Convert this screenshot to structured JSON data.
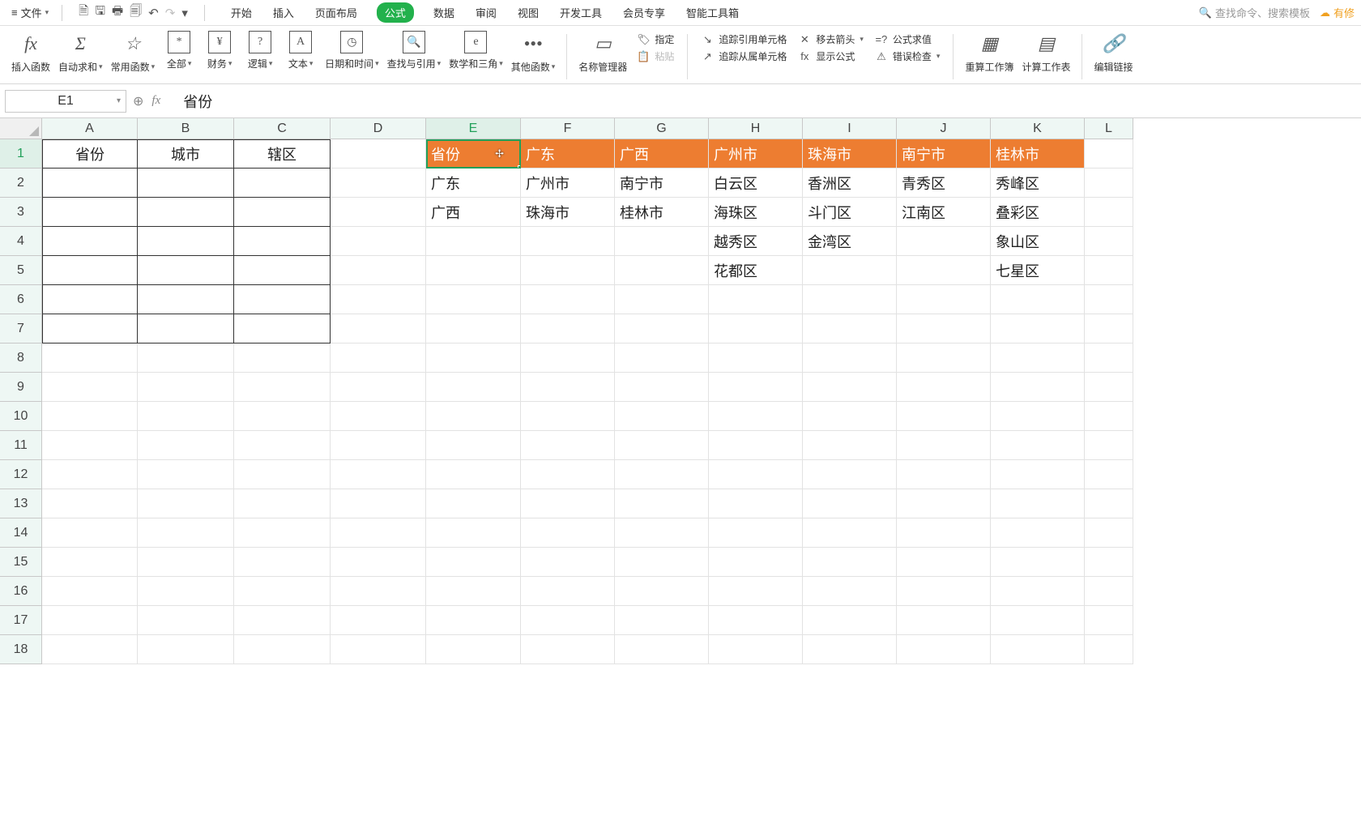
{
  "menu": {
    "file": "文件",
    "tabs": [
      "开始",
      "插入",
      "页面布局",
      "公式",
      "数据",
      "审阅",
      "视图",
      "开发工具",
      "会员专享",
      "智能工具箱"
    ],
    "active_tab": "公式",
    "search_placeholder": "查找命令、搜索模板",
    "cloud": "有修"
  },
  "ribbon": {
    "insert_fn": "插入函数",
    "auto_sum": "自动求和",
    "common_fn": "常用函数",
    "all": "全部",
    "finance": "财务",
    "logic": "逻辑",
    "text": "文本",
    "datetime": "日期和时间",
    "lookup": "查找与引用",
    "math": "数学和三角",
    "other_fn": "其他函数",
    "name_mgr": "名称管理器",
    "specify": "指定",
    "paste": "粘贴",
    "trace_precedents": "追踪引用单元格",
    "trace_dependents": "追踪从属单元格",
    "remove_arrows": "移去箭头",
    "show_formulas": "显示公式",
    "eval_formula": "公式求值",
    "error_check": "错误检查",
    "recalc_workbook": "重算工作簿",
    "calc_sheet": "计算工作表",
    "edit_links": "编辑链接"
  },
  "namebox": "E1",
  "formula": "省份",
  "columns": [
    "A",
    "B",
    "C",
    "D",
    "E",
    "F",
    "G",
    "H",
    "I",
    "J",
    "K",
    "L"
  ],
  "rows": [
    "1",
    "2",
    "3",
    "4",
    "5",
    "6",
    "7",
    "8",
    "9",
    "10",
    "11",
    "12",
    "13",
    "14",
    "15",
    "16",
    "17",
    "18"
  ],
  "data": {
    "A1": "省份",
    "B1": "城市",
    "C1": "辖区",
    "E1": "省份",
    "F1": "广东",
    "G1": "广西",
    "H1": "广州市",
    "I1": "珠海市",
    "J1": "南宁市",
    "K1": "桂林市",
    "E2": "广东",
    "F2": "广州市",
    "G2": "南宁市",
    "H2": "白云区",
    "I2": "香洲区",
    "J2": "青秀区",
    "K2": "秀峰区",
    "E3": "广西",
    "F3": "珠海市",
    "G3": "桂林市",
    "H3": "海珠区",
    "I3": "斗门区",
    "J3": "江南区",
    "K3": "叠彩区",
    "H4": "越秀区",
    "I4": "金湾区",
    "K4": "象山区",
    "H5": "花都区",
    "K5": "七星区"
  }
}
